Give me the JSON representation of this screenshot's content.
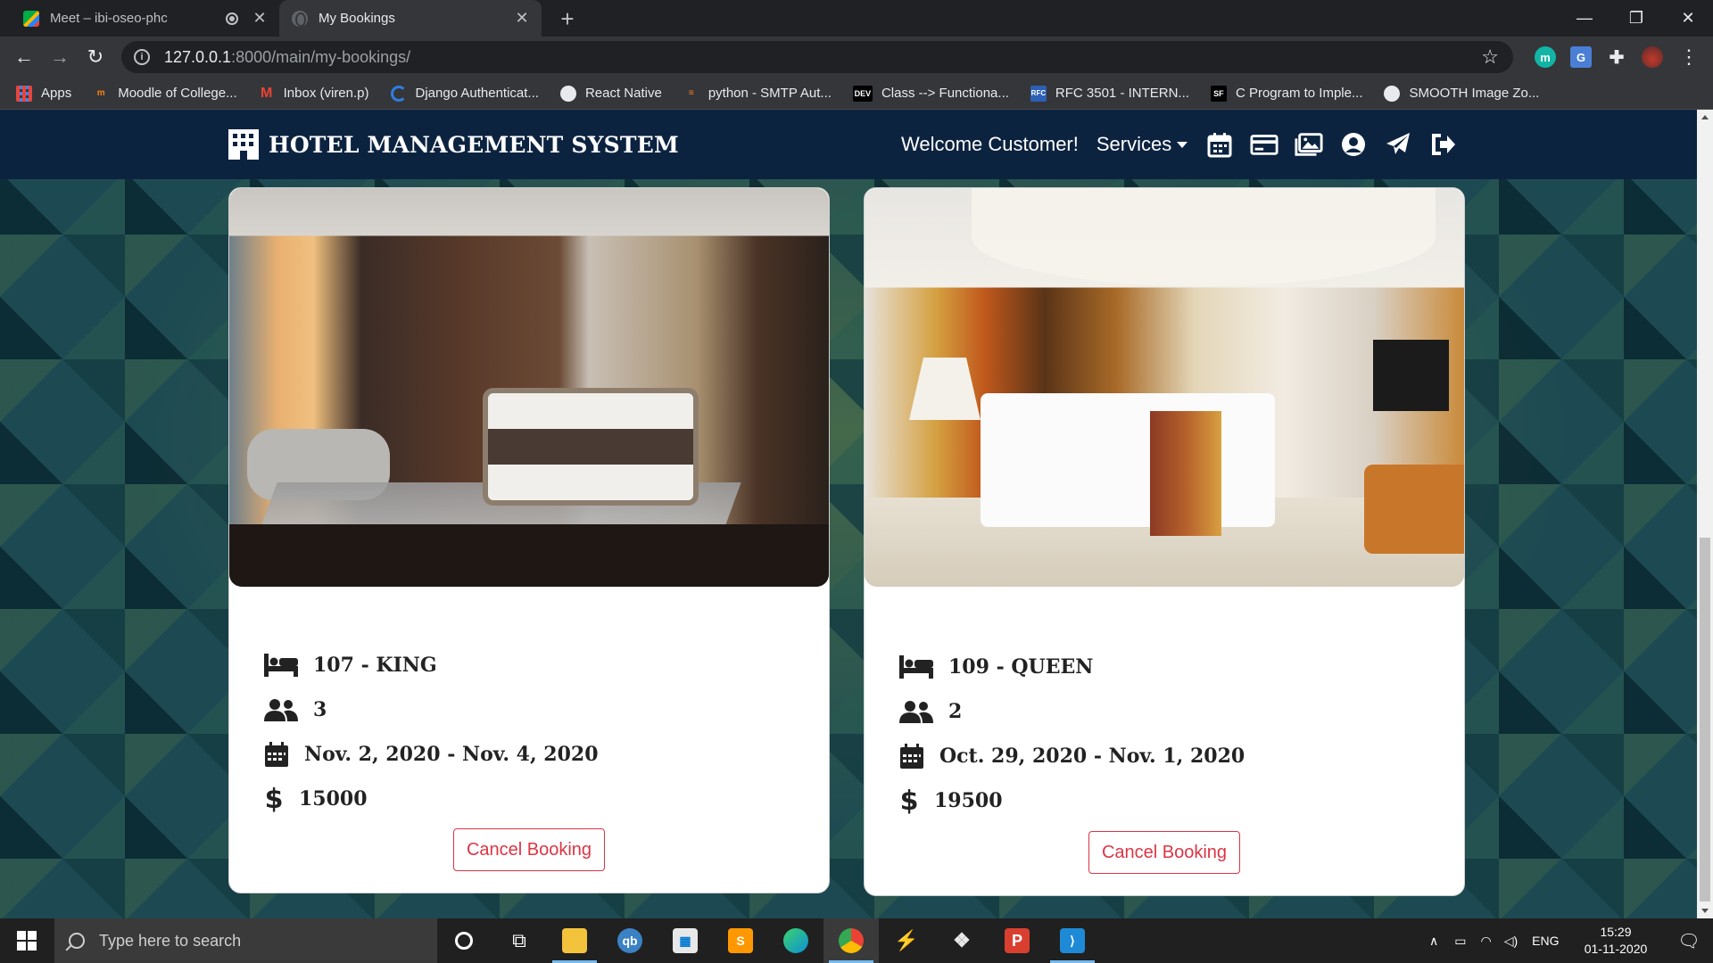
{
  "browser": {
    "tabs": [
      {
        "title": "Meet – ibi-oseo-phc",
        "active": false
      },
      {
        "title": "My Bookings",
        "active": true
      }
    ],
    "url_host": "127.0.0.1",
    "url_path": ":8000/main/my-bookings/",
    "bookmarks": [
      {
        "label": "Apps",
        "icon": "apps-grid-icon"
      },
      {
        "label": "Moodle of College...",
        "icon": "moodle-icon"
      },
      {
        "label": "Inbox (viren.p)",
        "icon": "gmail-icon"
      },
      {
        "label": "Django Authenticat...",
        "icon": "django-icon"
      },
      {
        "label": "React Native",
        "icon": "globe-icon"
      },
      {
        "label": "python - SMTP Aut...",
        "icon": "stackoverflow-icon"
      },
      {
        "label": "Class --> Functiona...",
        "icon": "dev-icon"
      },
      {
        "label": "RFC 3501 - INTERN...",
        "icon": "rfc-icon"
      },
      {
        "label": "C Program to Imple...",
        "icon": "sf-icon"
      },
      {
        "label": "SMOOTH Image Zo...",
        "icon": "globe-icon"
      }
    ]
  },
  "navbar": {
    "brand": "HOTEL MANAGEMENT SYSTEM",
    "welcome": "Welcome Customer!",
    "services": "Services"
  },
  "bookings": [
    {
      "room": "107 - KING",
      "guests": "3",
      "dates": "Nov. 2, 2020 - Nov. 4, 2020",
      "price": "15000",
      "action": "Cancel Booking"
    },
    {
      "room": "109 - QUEEN",
      "guests": "2",
      "dates": "Oct. 29, 2020 - Nov. 1, 2020",
      "price": "19500",
      "action": "Cancel Booking"
    }
  ],
  "taskbar": {
    "search_placeholder": "Type here to search",
    "language": "ENG",
    "time": "15:29",
    "date": "01-11-2020"
  },
  "colors": {
    "navbar": "#0c2340",
    "cancel": "#dc3545"
  }
}
